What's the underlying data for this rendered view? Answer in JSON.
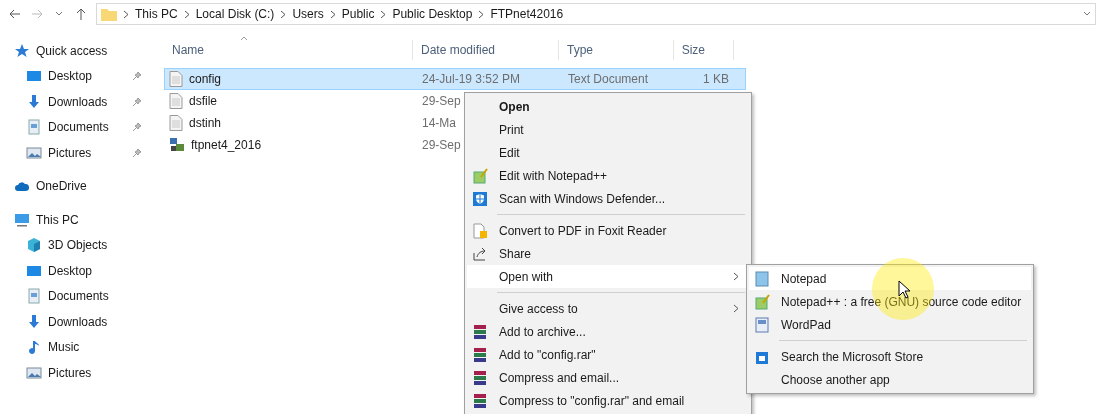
{
  "address_bar": {
    "path": [
      "This PC",
      "Local Disk (C:)",
      "Users",
      "Public",
      "Public Desktop",
      "FTPnet42016"
    ]
  },
  "sidebar": {
    "items": [
      {
        "label": "Quick access",
        "kind": "star",
        "children": [
          {
            "label": "Desktop",
            "kind": "desktop",
            "pinned": true
          },
          {
            "label": "Downloads",
            "kind": "download",
            "pinned": true
          },
          {
            "label": "Documents",
            "kind": "document",
            "pinned": true
          },
          {
            "label": "Pictures",
            "kind": "pictures",
            "pinned": true
          }
        ]
      },
      {
        "label": "OneDrive",
        "kind": "cloud"
      },
      {
        "label": "This PC",
        "kind": "pc",
        "children": [
          {
            "label": "3D Objects",
            "kind": "cube"
          },
          {
            "label": "Desktop",
            "kind": "desktop"
          },
          {
            "label": "Documents",
            "kind": "document"
          },
          {
            "label": "Downloads",
            "kind": "download"
          },
          {
            "label": "Music",
            "kind": "music"
          },
          {
            "label": "Pictures",
            "kind": "pictures"
          }
        ]
      }
    ]
  },
  "table": {
    "columns": [
      "Name",
      "Date modified",
      "Type",
      "Size"
    ],
    "rows": [
      {
        "name": "config",
        "kind": "text",
        "date": "24-Jul-19 3:52 PM",
        "type": "Text Document",
        "size": "1 KB",
        "selected": true
      },
      {
        "name": "dsfile",
        "kind": "text",
        "date": "29-Sep",
        "selected": false
      },
      {
        "name": "dstinh",
        "kind": "text",
        "date": "14-Ma",
        "selected": false
      },
      {
        "name": "ftpnet4_2016",
        "kind": "app",
        "date": "29-Sep",
        "selected": false
      }
    ]
  },
  "context_menu": {
    "items": [
      {
        "kind": "plain",
        "label": "Open",
        "default": true
      },
      {
        "kind": "plain",
        "label": "Print"
      },
      {
        "kind": "plain",
        "label": "Edit"
      },
      {
        "kind": "notepadpp",
        "label": "Edit with Notepad++"
      },
      {
        "kind": "defender",
        "label": "Scan with Windows Defender..."
      },
      {
        "kind": "separator"
      },
      {
        "kind": "pdf",
        "label": "Convert to PDF in Foxit Reader"
      },
      {
        "kind": "share",
        "label": "Share"
      },
      {
        "kind": "plain",
        "label": "Open with",
        "submenu": true,
        "selected": true
      },
      {
        "kind": "separator"
      },
      {
        "kind": "plain",
        "label": "Give access to",
        "submenu": true
      },
      {
        "kind": "rar",
        "label": "Add to archive..."
      },
      {
        "kind": "rar",
        "label": "Add to \"config.rar\""
      },
      {
        "kind": "rar",
        "label": "Compress and email..."
      },
      {
        "kind": "rar",
        "label": "Compress to \"config.rar\" and email"
      }
    ]
  },
  "submenu": {
    "items": [
      {
        "kind": "notepad",
        "label": "Notepad",
        "selected": true
      },
      {
        "kind": "notepadpp",
        "label": "Notepad++ : a free (GNU) source code editor",
        "selected": false
      },
      {
        "kind": "wordpad",
        "label": "WordPad",
        "selected": false
      },
      {
        "kind": "separator"
      },
      {
        "kind": "store",
        "label": "Search the Microsoft Store",
        "selected": false
      },
      {
        "kind": "plain",
        "label": "Choose another app",
        "selected": false
      }
    ]
  }
}
